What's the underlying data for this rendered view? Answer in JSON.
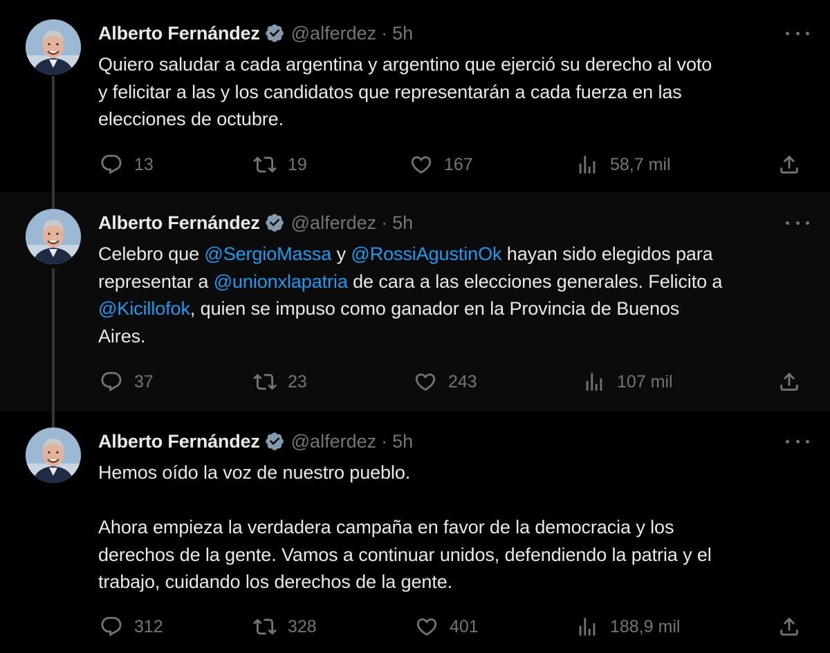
{
  "tweets": [
    {
      "author": {
        "name": "Alberto Fernández",
        "handle": "@alferdez",
        "time": "5h",
        "separator": "·"
      },
      "text_parts": [
        {
          "text": "Quiero saludar a cada argentina y argentino que ejerció su derecho al voto\ny felicitar a las y los candidatos que representarán a cada fuerza en las\nelecciones de octubre.",
          "mention": false
        }
      ],
      "stats": {
        "replies": "13",
        "retweets": "19",
        "likes": "167",
        "views": "58,7 mil"
      }
    },
    {
      "author": {
        "name": "Alberto Fernández",
        "handle": "@alferdez",
        "time": "5h",
        "separator": "·"
      },
      "text_parts": [
        {
          "text": "Celebro que ",
          "mention": false
        },
        {
          "text": "@SergioMassa",
          "mention": true
        },
        {
          "text": " y ",
          "mention": false
        },
        {
          "text": "@RossiAgustinOk",
          "mention": true
        },
        {
          "text": " hayan sido elegidos para\nrepresentar a ",
          "mention": false
        },
        {
          "text": "@unionxlapatria",
          "mention": true
        },
        {
          "text": " de cara a las elecciones generales. Felicito a\n",
          "mention": false
        },
        {
          "text": "@Kicillofok",
          "mention": true
        },
        {
          "text": ", quien se impuso como ganador en la Provincia de Buenos\nAires.",
          "mention": false
        }
      ],
      "stats": {
        "replies": "37",
        "retweets": "23",
        "likes": "243",
        "views": "107 mil"
      }
    },
    {
      "author": {
        "name": "Alberto Fernández",
        "handle": "@alferdez",
        "time": "5h",
        "separator": "·"
      },
      "text_parts": [
        {
          "text": "Hemos oído la voz de nuestro pueblo.\n\nAhora empieza la verdadera campaña en favor de la democracia y los\nderechos de la gente. Vamos a continuar unidos, defendiendo la patria y el\ntrabajo, cuidando los derechos de la gente.",
          "mention": false
        }
      ],
      "stats": {
        "replies": "312",
        "retweets": "328",
        "likes": "401",
        "views": "188,9 mil"
      }
    }
  ],
  "icons": {
    "reply": "reply-icon",
    "retweet": "retweet-icon",
    "like": "like-icon",
    "views": "views-icon",
    "share": "share-icon",
    "verified": "verified-badge-icon",
    "more": "more-options-icon"
  },
  "colors": {
    "background": "#000000",
    "alt_background": "#0b0b0b",
    "text": "#e7e9ea",
    "muted": "#71767b",
    "link": "#1d9bf0",
    "verified_badge": "#829aab",
    "thread_line": "#333639"
  }
}
